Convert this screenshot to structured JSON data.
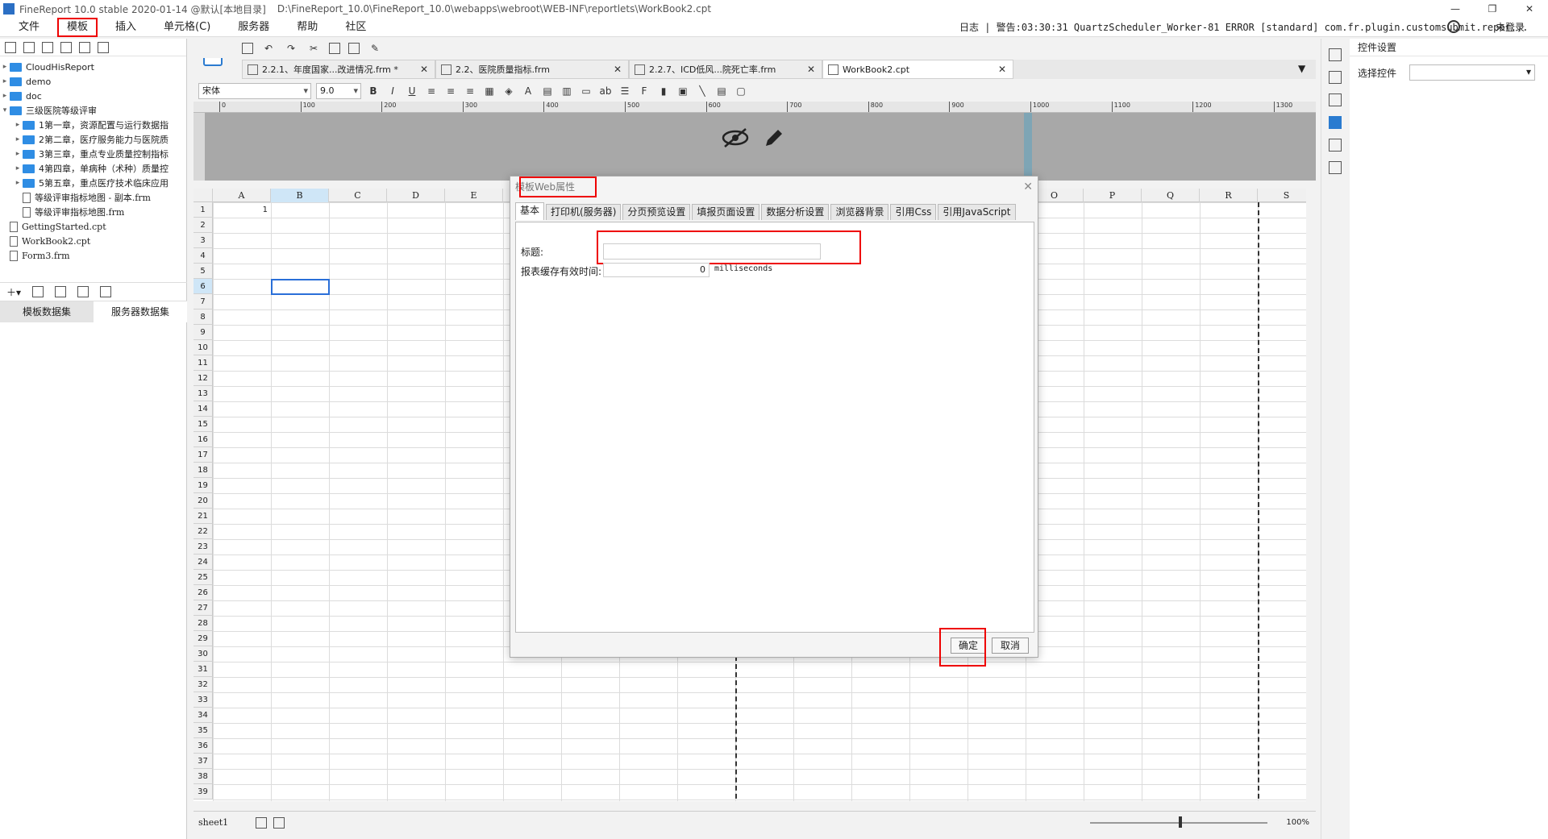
{
  "titlebar": {
    "app": "FineReport 10.0 stable 2020-01-14 @默认[本地目录]",
    "path": "D:\\FineReport_10.0\\FineReport_10.0\\webapps\\webroot\\WEB-INF\\reportlets\\WorkBook2.cpt"
  },
  "menu": {
    "items": [
      "文件",
      "模板",
      "插入",
      "单元格(C)",
      "服务器",
      "帮助",
      "社区"
    ],
    "log": "日志 | 警告:03:30:31 QuartzScheduler_Worker-81 ERROR [standard] com.fr.plugin.customsubmit.repor...",
    "login": "未登录"
  },
  "tree": {
    "items": [
      {
        "label": "CloudHisReport",
        "kind": "folder",
        "level": 0
      },
      {
        "label": "demo",
        "kind": "folder",
        "level": 0
      },
      {
        "label": "doc",
        "kind": "folder",
        "level": 0
      },
      {
        "label": "三级医院等级评审",
        "kind": "folder",
        "level": 0
      },
      {
        "label": "1第一章，资源配置与运行数据指",
        "kind": "folder",
        "level": 1
      },
      {
        "label": "2第二章，医疗服务能力与医院质",
        "kind": "folder",
        "level": 1
      },
      {
        "label": "3第三章，重点专业质量控制指标",
        "kind": "folder",
        "level": 1
      },
      {
        "label": "4第四章，单病种（术种）质量控",
        "kind": "folder",
        "level": 1
      },
      {
        "label": "5第五章，重点医疗技术临床应用",
        "kind": "folder",
        "level": 1
      },
      {
        "label": "等级评审指标地图 - 副本.frm",
        "kind": "file",
        "level": 1
      },
      {
        "label": "等级评审指标地图.frm",
        "kind": "file",
        "level": 1
      },
      {
        "label": "GettingStarted.cpt",
        "kind": "file",
        "level": 0
      },
      {
        "label": "WorkBook2.cpt",
        "kind": "file",
        "level": 0
      },
      {
        "label": "Form3.frm",
        "kind": "file",
        "level": 0
      }
    ]
  },
  "datasets": {
    "tab_template": "模板数据集",
    "tab_server": "服务器数据集"
  },
  "filetabs": [
    {
      "label": "2.2.1、年度国家...改进情况.frm *"
    },
    {
      "label": "2.2、医院质量指标.frm"
    },
    {
      "label": "2.2.7、ICD低风...院死亡率.frm"
    },
    {
      "label": "WorkBook2.cpt"
    }
  ],
  "format": {
    "font": "宋体",
    "size": "9.0"
  },
  "ruler": [
    "0",
    "100",
    "200",
    "300",
    "400",
    "500",
    "600",
    "700",
    "800",
    "900",
    "1000",
    "1100",
    "1200",
    "1300"
  ],
  "grid": {
    "columns": [
      "A",
      "B",
      "C",
      "D",
      "E",
      "F",
      "G",
      "H",
      "I",
      "J",
      "K",
      "L",
      "M",
      "N",
      "O",
      "P",
      "Q",
      "R",
      "S"
    ],
    "rows": [
      "1",
      "2",
      "3",
      "4",
      "5",
      "6",
      "7",
      "8",
      "9",
      "10",
      "11",
      "12",
      "13",
      "14",
      "15",
      "16",
      "17",
      "18",
      "19",
      "20",
      "21",
      "22",
      "23",
      "24",
      "25",
      "26",
      "27",
      "28",
      "29",
      "30",
      "31",
      "32",
      "33",
      "34",
      "35",
      "36",
      "37",
      "38",
      "39"
    ],
    "cellA1": "1",
    "selected": "B6"
  },
  "sheetbar": {
    "sheet": "sheet1",
    "zoom": "100%"
  },
  "rightpanel": {
    "title": "控件设置",
    "select_label": "选择控件",
    "select_value": ""
  },
  "dialog": {
    "title": "模板Web属性",
    "tabs": [
      "基本",
      "打印机(服务器)",
      "分页预览设置",
      "填报页面设置",
      "数据分析设置",
      "浏览器背景",
      "引用Css",
      "引用JavaScript"
    ],
    "active_tab": "基本",
    "label_title": "标题:",
    "title_value": "",
    "label_cache": "报表缓存有效时间:",
    "cache_value": "0",
    "cache_unit": "milliseconds",
    "ok": "确定",
    "cancel": "取消"
  }
}
